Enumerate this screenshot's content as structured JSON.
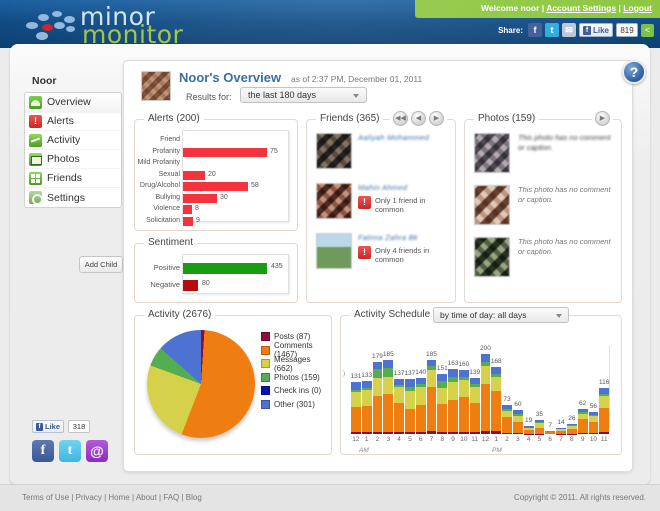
{
  "header": {
    "logo_line1": "minor",
    "logo_line2": "monitor",
    "welcome": "Welcome  noor  |  ",
    "account_settings": "Account Settings",
    "sep": "  |  ",
    "logout": "Logout",
    "share_label": "Share:",
    "like_label": "Like",
    "like_count": "819",
    "icons": {
      "facebook": "f",
      "twitter": "t",
      "mail": "✉",
      "share": "<"
    }
  },
  "sidebar": {
    "title": "Noor",
    "items": [
      {
        "label": "Overview",
        "icon": "gauge-icon",
        "active": true
      },
      {
        "label": "Alerts",
        "icon": "warning-icon",
        "active": false
      },
      {
        "label": "Activity",
        "icon": "activity-icon",
        "active": false
      },
      {
        "label": "Photos",
        "icon": "photo-icon",
        "active": false
      },
      {
        "label": "Friends",
        "icon": "friends-icon",
        "active": false
      },
      {
        "label": "Settings",
        "icon": "gear-icon",
        "active": false
      }
    ],
    "add_child": "Add Child",
    "like_label": "Like",
    "like_count": "318",
    "social": {
      "facebook": "f",
      "twitter": "t",
      "email": "@"
    }
  },
  "overview": {
    "title": "Noor's Overview",
    "as_of": "as of 2:37 PM, December 01, 2011",
    "results_label": "Results for:",
    "results_value": "the last 180 days",
    "help": "?"
  },
  "alerts": {
    "legend": "Alerts (200)",
    "max": 75,
    "rows": [
      {
        "label": "Friend",
        "value": 0,
        "display": ""
      },
      {
        "label": "Profanity",
        "value": 75,
        "display": "75"
      },
      {
        "label": "Mild Profanity",
        "value": 0,
        "display": ""
      },
      {
        "label": "Sexual",
        "value": 20,
        "display": "20"
      },
      {
        "label": "Drug/Alcohol",
        "value": 58,
        "display": "58"
      },
      {
        "label": "Bullying",
        "value": 30,
        "display": "30"
      },
      {
        "label": "Violence",
        "value": 8,
        "display": "8"
      },
      {
        "label": "Solicitation",
        "value": 9,
        "display": "9"
      }
    ],
    "bar_color": "#f5333f"
  },
  "sentiment": {
    "legend": "Sentiment",
    "max": 435,
    "rows": [
      {
        "label": "Positive",
        "value": 435,
        "display": "435",
        "color": "#179c12"
      },
      {
        "label": "Negative",
        "value": 80,
        "display": "80",
        "color": "#b50d0d"
      }
    ]
  },
  "friends": {
    "legend": "Friends (365)",
    "nav": {
      "first": "◀◀",
      "prev": "◀",
      "next": "▶"
    },
    "items": [
      {
        "name": "Aaliyah Mohammed",
        "warning": ""
      },
      {
        "name": "Mahin Ahmed",
        "warning": "Only 1 friend in common"
      },
      {
        "name": "Fatima Zahra Bk",
        "warning": "Only 4 friends in common"
      }
    ]
  },
  "photos": {
    "legend": "Photos (159)",
    "nav": {
      "next": "▶"
    },
    "items": [
      {
        "caption": "This photo has no comment or caption.",
        "blurred": true
      },
      {
        "caption": "This photo has no comment or caption.",
        "blurred": false
      },
      {
        "caption": "This photo has no comment or caption.",
        "blurred": false
      }
    ]
  },
  "chart_data": [
    {
      "type": "pie",
      "title": "Activity (2676)",
      "legend_position": "right",
      "categories": [
        "Posts",
        "Comments",
        "Messages",
        "Photos",
        "Check ins",
        "Other"
      ],
      "values": [
        87,
        1467,
        662,
        159,
        0,
        301
      ],
      "labels": [
        "Posts (87)",
        "Comments (1467)",
        "Messages (662)",
        "Photos (159)",
        "Check ins (0)",
        "Other (301)"
      ],
      "colors": [
        "#8e0b3a",
        "#ee7d12",
        "#d6d14a",
        "#55ad51",
        "#0b12b5",
        "#4d72d1"
      ]
    },
    {
      "type": "bar",
      "title": "Activity Schedule",
      "selector": "by time of day: all days",
      "stacked": true,
      "xlabel": "",
      "ylabel": ")",
      "ampm": [
        "AM",
        "PM"
      ],
      "categories": [
        "12",
        "1",
        "2",
        "3",
        "4",
        "5",
        "6",
        "7",
        "8",
        "9",
        "10",
        "11",
        "12",
        "1",
        "2",
        "3",
        "4",
        "5",
        "6",
        "7",
        "8",
        "9",
        "10",
        "11"
      ],
      "totals": [
        131,
        133,
        179,
        185,
        137,
        137,
        140,
        185,
        151,
        163,
        160,
        139,
        200,
        168,
        73,
        60,
        19,
        35,
        7,
        14,
        26,
        62,
        56,
        116
      ],
      "total_labels": [
        "131",
        "133",
        "179",
        "185",
        "137",
        "137",
        "140",
        "185",
        "151",
        "163",
        "160",
        "139",
        "200",
        "168",
        "73",
        "60",
        "19",
        "35",
        "7",
        "14",
        "26",
        "62",
        "56",
        "116"
      ],
      "series": [
        {
          "name": "Posts",
          "color": "#8e0b3a",
          "values": [
            5,
            5,
            6,
            6,
            5,
            5,
            5,
            7,
            6,
            6,
            6,
            6,
            8,
            7,
            3,
            3,
            1,
            1,
            0,
            1,
            1,
            3,
            2,
            4
          ]
        },
        {
          "name": "Comments",
          "color": "#ee7d12",
          "values": [
            62,
            66,
            88,
            94,
            72,
            58,
            68,
            110,
            70,
            78,
            86,
            72,
            118,
            100,
            40,
            28,
            8,
            14,
            4,
            7,
            12,
            34,
            28,
            62
          ]
        },
        {
          "name": "Messages",
          "color": "#d6d14a",
          "values": [
            38,
            38,
            46,
            42,
            40,
            44,
            44,
            44,
            38,
            46,
            42,
            40,
            44,
            36,
            14,
            14,
            5,
            12,
            2,
            4,
            8,
            14,
            14,
            28
          ]
        },
        {
          "name": "Photos",
          "color": "#55ad51",
          "values": [
            6,
            6,
            22,
            24,
            6,
            10,
            8,
            8,
            18,
            12,
            8,
            7,
            10,
            8,
            5,
            4,
            2,
            4,
            1,
            1,
            2,
            3,
            4,
            6
          ]
        },
        {
          "name": "Other",
          "color": "#4d72d1",
          "values": [
            20,
            18,
            17,
            19,
            14,
            20,
            15,
            16,
            19,
            21,
            18,
            14,
            20,
            17,
            11,
            11,
            3,
            4,
            0,
            1,
            3,
            8,
            8,
            16
          ]
        }
      ],
      "ymax": 200
    }
  ],
  "footer": {
    "links": [
      "Terms of Use",
      "Privacy",
      "Home",
      "About",
      "FAQ",
      "Blog"
    ],
    "links_text": "Terms of Use | Privacy | Home | About | FAQ | Blog",
    "copyright": "Copyright © 2011. All rights reserved."
  }
}
